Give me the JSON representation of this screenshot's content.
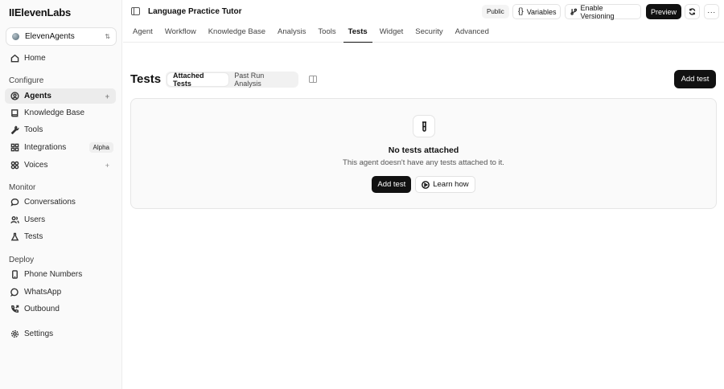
{
  "brand": {
    "name": "IIElevenLabs"
  },
  "workspace": {
    "label": "ElevenAgents"
  },
  "sidebar": {
    "home": "Home",
    "sections": {
      "configure": "Configure",
      "monitor": "Monitor",
      "deploy": "Deploy"
    },
    "items": {
      "agents": "Agents",
      "knowledge_base": "Knowledge Base",
      "tools": "Tools",
      "integrations": "Integrations",
      "integrations_badge": "Alpha",
      "voices": "Voices",
      "conversations": "Conversations",
      "users": "Users",
      "tests": "Tests",
      "phone_numbers": "Phone Numbers",
      "whatsapp": "WhatsApp",
      "outbound": "Outbound",
      "settings": "Settings"
    },
    "plus": "+"
  },
  "header": {
    "title": "Language Practice Tutor",
    "visibility": "Public",
    "variables_label": "Variables",
    "versioning_label": "Enable Versioning",
    "preview_label": "Preview",
    "more_label": "···"
  },
  "tabs": [
    "Agent",
    "Workflow",
    "Knowledge Base",
    "Analysis",
    "Tools",
    "Tests",
    "Widget",
    "Security",
    "Advanced"
  ],
  "active_tab": "Tests",
  "main": {
    "heading": "Tests",
    "segments": [
      "Attached Tests",
      "Past Run Analysis"
    ],
    "add_test_label": "Add test",
    "empty": {
      "title": "No tests attached",
      "description": "This agent doesn't have any tests attached to it.",
      "primary_label": "Add test",
      "secondary_label": "Learn how"
    }
  },
  "colors": {
    "accent": "#111111",
    "sidebar_bg": "#fafafa",
    "active_item_bg": "#ececec"
  }
}
